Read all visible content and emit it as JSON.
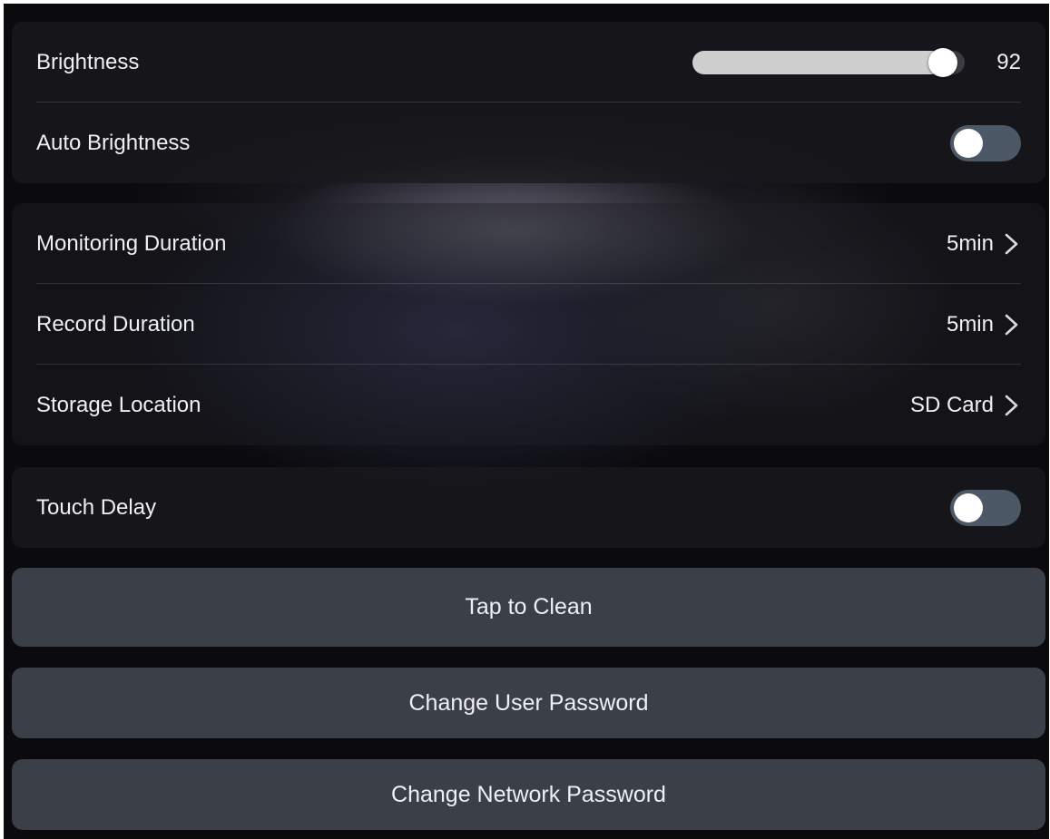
{
  "display": {
    "brightness": {
      "label": "Brightness",
      "value": 92,
      "value_text": "92",
      "max": 100
    },
    "auto_brightness": {
      "label": "Auto Brightness",
      "enabled": false
    }
  },
  "recording": {
    "monitoring_duration": {
      "label": "Monitoring Duration",
      "value": "5min"
    },
    "record_duration": {
      "label": "Record Duration",
      "value": "5min"
    },
    "storage_location": {
      "label": "Storage Location",
      "value": "SD Card"
    }
  },
  "touch": {
    "touch_delay": {
      "label": "Touch Delay",
      "enabled": false
    }
  },
  "actions": {
    "tap_to_clean": "Tap to Clean",
    "change_user_password": "Change User Password",
    "change_network_password": "Change Network Password"
  },
  "icons": {
    "row_chevron": "chevron-right-icon"
  },
  "colors": {
    "toggle_off_track": "#4c5866",
    "slider_fill": "#cfcfcf",
    "button_background": "#3b3f48"
  }
}
